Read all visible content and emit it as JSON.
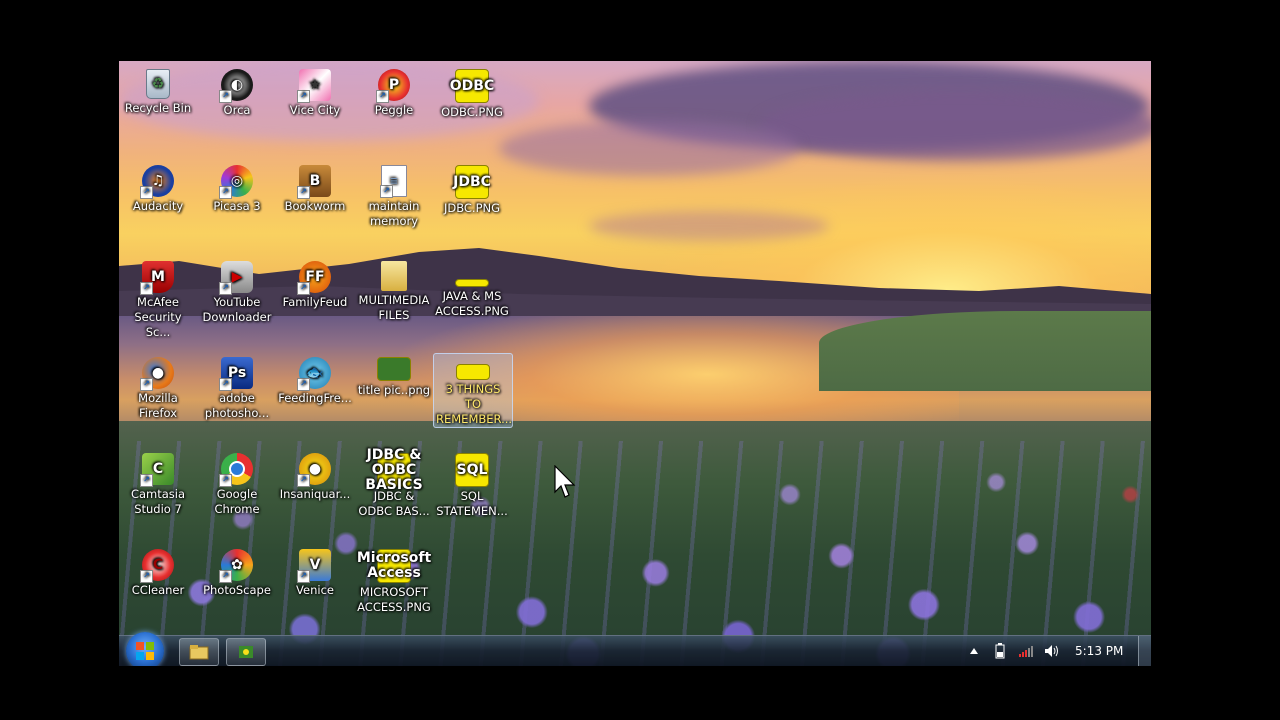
{
  "desktop": {
    "icons": [
      {
        "label": "Recycle Bin",
        "icon": "recycle-bin-icon"
      },
      {
        "label": "Orca",
        "icon": "orca-icon"
      },
      {
        "label": "Vice City",
        "icon": "vice-city-icon"
      },
      {
        "label": "Peggle",
        "icon": "peggle-icon"
      },
      {
        "label": "ODBC.PNG",
        "icon": "png-file-icon",
        "thumb": "ODBC"
      },
      {
        "label": "Audacity",
        "icon": "audacity-icon"
      },
      {
        "label": "Picasa 3",
        "icon": "picasa-icon"
      },
      {
        "label": "Bookworm",
        "icon": "bookworm-icon"
      },
      {
        "label": "maintain memory",
        "icon": "document-icon"
      },
      {
        "label": "JDBC.PNG",
        "icon": "png-file-icon",
        "thumb": "JDBC"
      },
      {
        "label": "McAfee Security Sc...",
        "icon": "mcafee-icon"
      },
      {
        "label": "YouTube Downloader",
        "icon": "youtube-downloader-icon"
      },
      {
        "label": "FamilyFeud",
        "icon": "familyfeud-icon"
      },
      {
        "label": "MULTIMEDIA FILES",
        "icon": "folder-icon"
      },
      {
        "label": "JAVA & MS ACCESS.PNG",
        "icon": "png-file-icon",
        "thumb": ""
      },
      {
        "label": "Mozilla Firefox",
        "icon": "firefox-icon"
      },
      {
        "label": "adobe photosho...",
        "icon": "photoshop-icon"
      },
      {
        "label": "FeedingFre...",
        "icon": "feedingfrenzy-icon"
      },
      {
        "label": "title pic..png",
        "icon": "png-file-icon",
        "thumb": ""
      },
      {
        "label": "3 THINGS TO REMEMBER...",
        "icon": "png-file-icon",
        "thumb": ""
      },
      {
        "label": "Camtasia Studio 7",
        "icon": "camtasia-icon"
      },
      {
        "label": "Google Chrome",
        "icon": "chrome-icon"
      },
      {
        "label": "Insaniquar...",
        "icon": "insaniquarium-icon"
      },
      {
        "label": "JDBC & ODBC BAS...",
        "icon": "png-file-icon",
        "thumb": "JDBC & ODBC BASICS"
      },
      {
        "label": "SQL STATEMEN...",
        "icon": "png-file-icon",
        "thumb": "SQL"
      },
      {
        "label": "CCleaner",
        "icon": "ccleaner-icon"
      },
      {
        "label": "PhotoScape",
        "icon": "photoscape-icon"
      },
      {
        "label": "Venice",
        "icon": "venice-icon"
      },
      {
        "label": "MICROSOFT ACCESS.PNG",
        "icon": "png-file-icon",
        "thumb": "Microsoft Access"
      }
    ],
    "selected_index": 19
  },
  "taskbar": {
    "clock": "5:13 PM",
    "start_icon": "windows-logo-icon",
    "pinned": [
      {
        "icon": "explorer-folder-icon"
      },
      {
        "icon": "camtasia-recorder-icon"
      }
    ],
    "tray": [
      {
        "icon": "show-hidden-icons-icon"
      },
      {
        "icon": "battery-icon"
      },
      {
        "icon": "network-signal-icon"
      },
      {
        "icon": "volume-icon"
      }
    ]
  },
  "colors": {
    "accent": "#2a6fd0",
    "png_thumb": "#f6e800"
  }
}
